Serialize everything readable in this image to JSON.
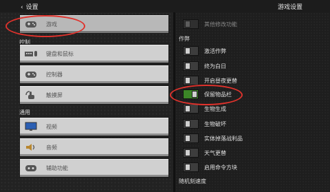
{
  "header": {
    "back_label": "设置",
    "title": "游戏设置"
  },
  "left_panel": {
    "game_button": "游戏",
    "section_controls": "控制",
    "controls": [
      {
        "label": "键盘和鼠标",
        "icon": "keyboard-mouse-icon"
      },
      {
        "label": "控制器",
        "icon": "controller-icon"
      },
      {
        "label": "触摸屏",
        "icon": "touch-icon"
      }
    ],
    "section_general": "通用",
    "general": [
      {
        "label": "视频",
        "icon": "monitor-icon"
      },
      {
        "label": "音频",
        "icon": "speaker-icon"
      },
      {
        "label": "辅助功能",
        "icon": "accessibility-icon"
      }
    ]
  },
  "right_panel": {
    "other_mods_label": "其他修改功能",
    "section_cheats": "作弊",
    "toggles": [
      {
        "label": "激活作弊",
        "on": false
      },
      {
        "label": "终为白日",
        "on": false
      },
      {
        "label": "开启昼夜更替",
        "on": false
      },
      {
        "label": "保留物品栏",
        "on": true
      },
      {
        "label": "生物生成",
        "on": false
      },
      {
        "label": "生物破坏",
        "on": false
      },
      {
        "label": "实体掉落战利品",
        "on": false
      },
      {
        "label": "天气更替",
        "on": false
      },
      {
        "label": "启用命令方块",
        "on": false
      }
    ],
    "random_tick_label": "随机刻速度"
  },
  "colors": {
    "toggle_on": "#3c8527",
    "annotation": "#e0322c"
  }
}
